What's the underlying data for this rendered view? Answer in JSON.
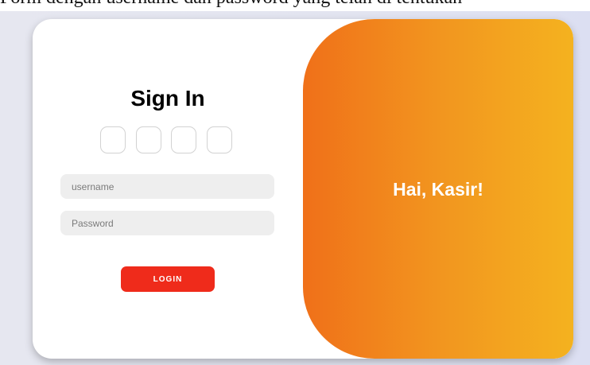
{
  "caption": {
    "text": "Form dengan username dan password yang telah di tentukan"
  },
  "login_form": {
    "title": "Sign In",
    "social_buttons": [
      {
        "icon": "blank-social-icon"
      },
      {
        "icon": "blank-social-icon"
      },
      {
        "icon": "blank-social-icon"
      },
      {
        "icon": "blank-social-icon"
      }
    ],
    "username_placeholder": "username",
    "username_value": "",
    "password_placeholder": "Password",
    "password_value": "",
    "login_label": "LOGIN"
  },
  "greeting_panel": {
    "text": "Hai, Kasir!"
  },
  "colors": {
    "accent_gradient_start": "#f07019",
    "accent_gradient_end": "#f4b21f",
    "login_button": "#ef2b1b",
    "input_background": "#eeeeee",
    "page_background": "#e4e5f0"
  }
}
